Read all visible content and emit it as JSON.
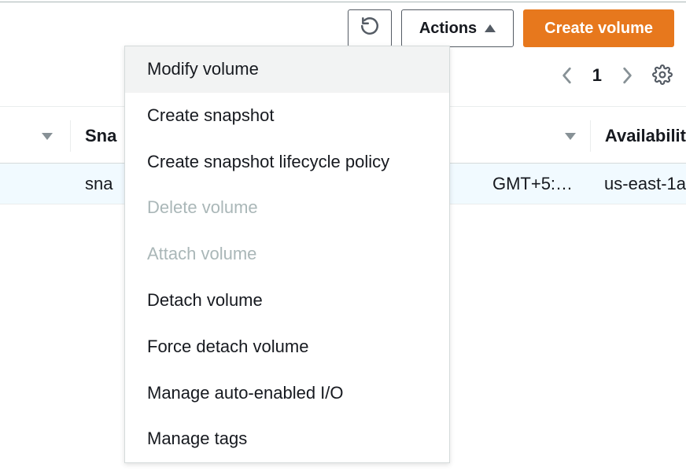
{
  "toolbar": {
    "actions_label": "Actions",
    "create_label": "Create volume"
  },
  "pager": {
    "page": "1"
  },
  "columns": {
    "partial_left": "",
    "snapshot_partial": "Sna",
    "availability_partial": "Availabilit"
  },
  "row": {
    "snapshot_partial": "sna",
    "time_partial": "GMT+5:…",
    "availability": "us-east-1a"
  },
  "menu": {
    "items": [
      {
        "label": "Modify volume",
        "disabled": false
      },
      {
        "label": "Create snapshot",
        "disabled": false
      },
      {
        "label": "Create snapshot lifecycle policy",
        "disabled": false
      },
      {
        "label": "Delete volume",
        "disabled": true
      },
      {
        "label": "Attach volume",
        "disabled": true
      },
      {
        "label": "Detach volume",
        "disabled": false
      },
      {
        "label": "Force detach volume",
        "disabled": false
      },
      {
        "label": "Manage auto-enabled I/O",
        "disabled": false
      },
      {
        "label": "Manage tags",
        "disabled": false
      }
    ]
  }
}
